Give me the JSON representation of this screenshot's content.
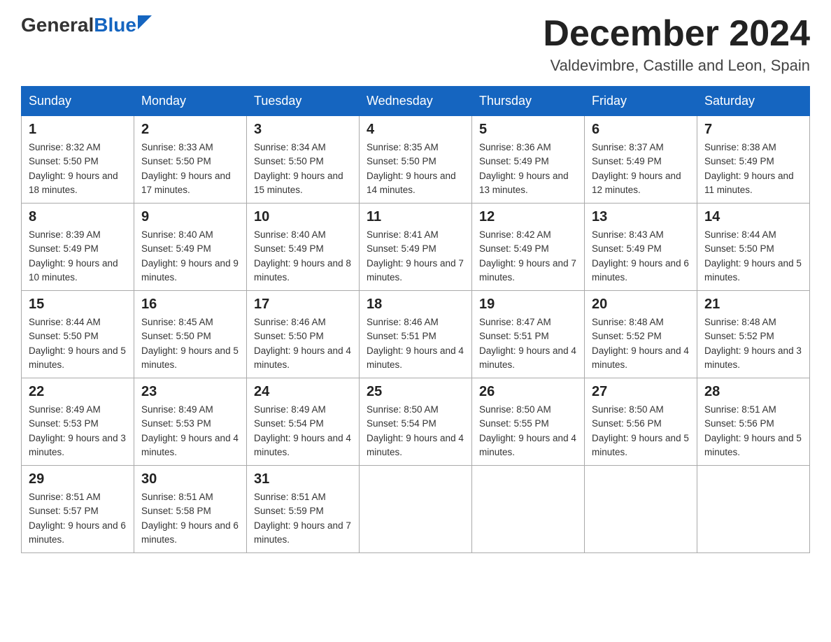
{
  "logo": {
    "general": "General",
    "blue": "Blue"
  },
  "title": "December 2024",
  "subtitle": "Valdevimbre, Castille and Leon, Spain",
  "days_of_week": [
    "Sunday",
    "Monday",
    "Tuesday",
    "Wednesday",
    "Thursday",
    "Friday",
    "Saturday"
  ],
  "weeks": [
    [
      {
        "day": "1",
        "sunrise": "Sunrise: 8:32 AM",
        "sunset": "Sunset: 5:50 PM",
        "daylight": "Daylight: 9 hours and 18 minutes."
      },
      {
        "day": "2",
        "sunrise": "Sunrise: 8:33 AM",
        "sunset": "Sunset: 5:50 PM",
        "daylight": "Daylight: 9 hours and 17 minutes."
      },
      {
        "day": "3",
        "sunrise": "Sunrise: 8:34 AM",
        "sunset": "Sunset: 5:50 PM",
        "daylight": "Daylight: 9 hours and 15 minutes."
      },
      {
        "day": "4",
        "sunrise": "Sunrise: 8:35 AM",
        "sunset": "Sunset: 5:50 PM",
        "daylight": "Daylight: 9 hours and 14 minutes."
      },
      {
        "day": "5",
        "sunrise": "Sunrise: 8:36 AM",
        "sunset": "Sunset: 5:49 PM",
        "daylight": "Daylight: 9 hours and 13 minutes."
      },
      {
        "day": "6",
        "sunrise": "Sunrise: 8:37 AM",
        "sunset": "Sunset: 5:49 PM",
        "daylight": "Daylight: 9 hours and 12 minutes."
      },
      {
        "day": "7",
        "sunrise": "Sunrise: 8:38 AM",
        "sunset": "Sunset: 5:49 PM",
        "daylight": "Daylight: 9 hours and 11 minutes."
      }
    ],
    [
      {
        "day": "8",
        "sunrise": "Sunrise: 8:39 AM",
        "sunset": "Sunset: 5:49 PM",
        "daylight": "Daylight: 9 hours and 10 minutes."
      },
      {
        "day": "9",
        "sunrise": "Sunrise: 8:40 AM",
        "sunset": "Sunset: 5:49 PM",
        "daylight": "Daylight: 9 hours and 9 minutes."
      },
      {
        "day": "10",
        "sunrise": "Sunrise: 8:40 AM",
        "sunset": "Sunset: 5:49 PM",
        "daylight": "Daylight: 9 hours and 8 minutes."
      },
      {
        "day": "11",
        "sunrise": "Sunrise: 8:41 AM",
        "sunset": "Sunset: 5:49 PM",
        "daylight": "Daylight: 9 hours and 7 minutes."
      },
      {
        "day": "12",
        "sunrise": "Sunrise: 8:42 AM",
        "sunset": "Sunset: 5:49 PM",
        "daylight": "Daylight: 9 hours and 7 minutes."
      },
      {
        "day": "13",
        "sunrise": "Sunrise: 8:43 AM",
        "sunset": "Sunset: 5:49 PM",
        "daylight": "Daylight: 9 hours and 6 minutes."
      },
      {
        "day": "14",
        "sunrise": "Sunrise: 8:44 AM",
        "sunset": "Sunset: 5:50 PM",
        "daylight": "Daylight: 9 hours and 5 minutes."
      }
    ],
    [
      {
        "day": "15",
        "sunrise": "Sunrise: 8:44 AM",
        "sunset": "Sunset: 5:50 PM",
        "daylight": "Daylight: 9 hours and 5 minutes."
      },
      {
        "day": "16",
        "sunrise": "Sunrise: 8:45 AM",
        "sunset": "Sunset: 5:50 PM",
        "daylight": "Daylight: 9 hours and 5 minutes."
      },
      {
        "day": "17",
        "sunrise": "Sunrise: 8:46 AM",
        "sunset": "Sunset: 5:50 PM",
        "daylight": "Daylight: 9 hours and 4 minutes."
      },
      {
        "day": "18",
        "sunrise": "Sunrise: 8:46 AM",
        "sunset": "Sunset: 5:51 PM",
        "daylight": "Daylight: 9 hours and 4 minutes."
      },
      {
        "day": "19",
        "sunrise": "Sunrise: 8:47 AM",
        "sunset": "Sunset: 5:51 PM",
        "daylight": "Daylight: 9 hours and 4 minutes."
      },
      {
        "day": "20",
        "sunrise": "Sunrise: 8:48 AM",
        "sunset": "Sunset: 5:52 PM",
        "daylight": "Daylight: 9 hours and 4 minutes."
      },
      {
        "day": "21",
        "sunrise": "Sunrise: 8:48 AM",
        "sunset": "Sunset: 5:52 PM",
        "daylight": "Daylight: 9 hours and 3 minutes."
      }
    ],
    [
      {
        "day": "22",
        "sunrise": "Sunrise: 8:49 AM",
        "sunset": "Sunset: 5:53 PM",
        "daylight": "Daylight: 9 hours and 3 minutes."
      },
      {
        "day": "23",
        "sunrise": "Sunrise: 8:49 AM",
        "sunset": "Sunset: 5:53 PM",
        "daylight": "Daylight: 9 hours and 4 minutes."
      },
      {
        "day": "24",
        "sunrise": "Sunrise: 8:49 AM",
        "sunset": "Sunset: 5:54 PM",
        "daylight": "Daylight: 9 hours and 4 minutes."
      },
      {
        "day": "25",
        "sunrise": "Sunrise: 8:50 AM",
        "sunset": "Sunset: 5:54 PM",
        "daylight": "Daylight: 9 hours and 4 minutes."
      },
      {
        "day": "26",
        "sunrise": "Sunrise: 8:50 AM",
        "sunset": "Sunset: 5:55 PM",
        "daylight": "Daylight: 9 hours and 4 minutes."
      },
      {
        "day": "27",
        "sunrise": "Sunrise: 8:50 AM",
        "sunset": "Sunset: 5:56 PM",
        "daylight": "Daylight: 9 hours and 5 minutes."
      },
      {
        "day": "28",
        "sunrise": "Sunrise: 8:51 AM",
        "sunset": "Sunset: 5:56 PM",
        "daylight": "Daylight: 9 hours and 5 minutes."
      }
    ],
    [
      {
        "day": "29",
        "sunrise": "Sunrise: 8:51 AM",
        "sunset": "Sunset: 5:57 PM",
        "daylight": "Daylight: 9 hours and 6 minutes."
      },
      {
        "day": "30",
        "sunrise": "Sunrise: 8:51 AM",
        "sunset": "Sunset: 5:58 PM",
        "daylight": "Daylight: 9 hours and 6 minutes."
      },
      {
        "day": "31",
        "sunrise": "Sunrise: 8:51 AM",
        "sunset": "Sunset: 5:59 PM",
        "daylight": "Daylight: 9 hours and 7 minutes."
      },
      null,
      null,
      null,
      null
    ]
  ]
}
